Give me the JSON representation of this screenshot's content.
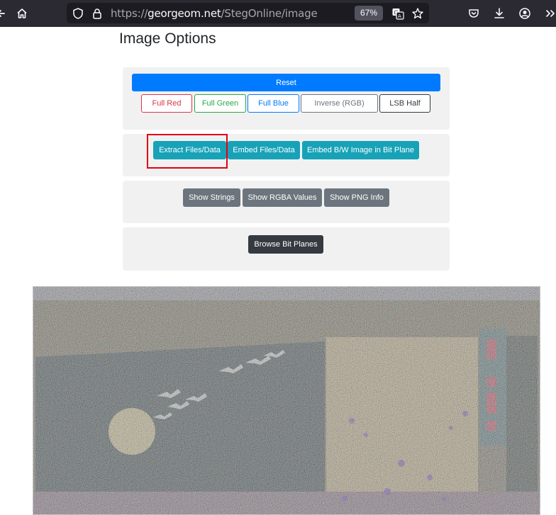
{
  "browser": {
    "url": {
      "protocol": "https://",
      "domain": "georgeom.net",
      "path": "/StegOnline/image"
    },
    "zoom": "67%",
    "icons": [
      "back-arrow-icon",
      "home-icon",
      "shield-icon",
      "lock-icon",
      "translate-icon",
      "star-icon",
      "pocket-icon",
      "download-icon",
      "account-icon",
      "overflow-chevron-icon"
    ]
  },
  "page": {
    "title": "Image Options"
  },
  "card1": {
    "reset_label": "Reset",
    "channel_buttons": [
      {
        "label": "Full Red"
      },
      {
        "label": "Full Green"
      },
      {
        "label": "Full Blue"
      },
      {
        "label": "Inverse (RGB)"
      },
      {
        "label": "LSB Half"
      }
    ]
  },
  "card2": {
    "buttons": [
      {
        "label": "Extract Files/Data"
      },
      {
        "label": "Embed Files/Data"
      },
      {
        "label": "Embed B/W Image in Bit Plane"
      }
    ]
  },
  "card3": {
    "buttons": [
      {
        "label": "Show Strings"
      },
      {
        "label": "Show RGBA Values"
      },
      {
        "label": "Show PNG Info"
      }
    ]
  },
  "card4": {
    "button_label": "Browse Bit Planes"
  },
  "colors": {
    "toolbar_bg": "#2b2a33",
    "urlbar_bg": "#1c1b22",
    "primary": "#007bff",
    "info": "#17a2b8",
    "secondary": "#6c757d",
    "dark": "#343a40",
    "danger": "#dc3545",
    "success": "#28a745",
    "highlight": "#e3000f",
    "card_bg": "#f1f1f1"
  }
}
